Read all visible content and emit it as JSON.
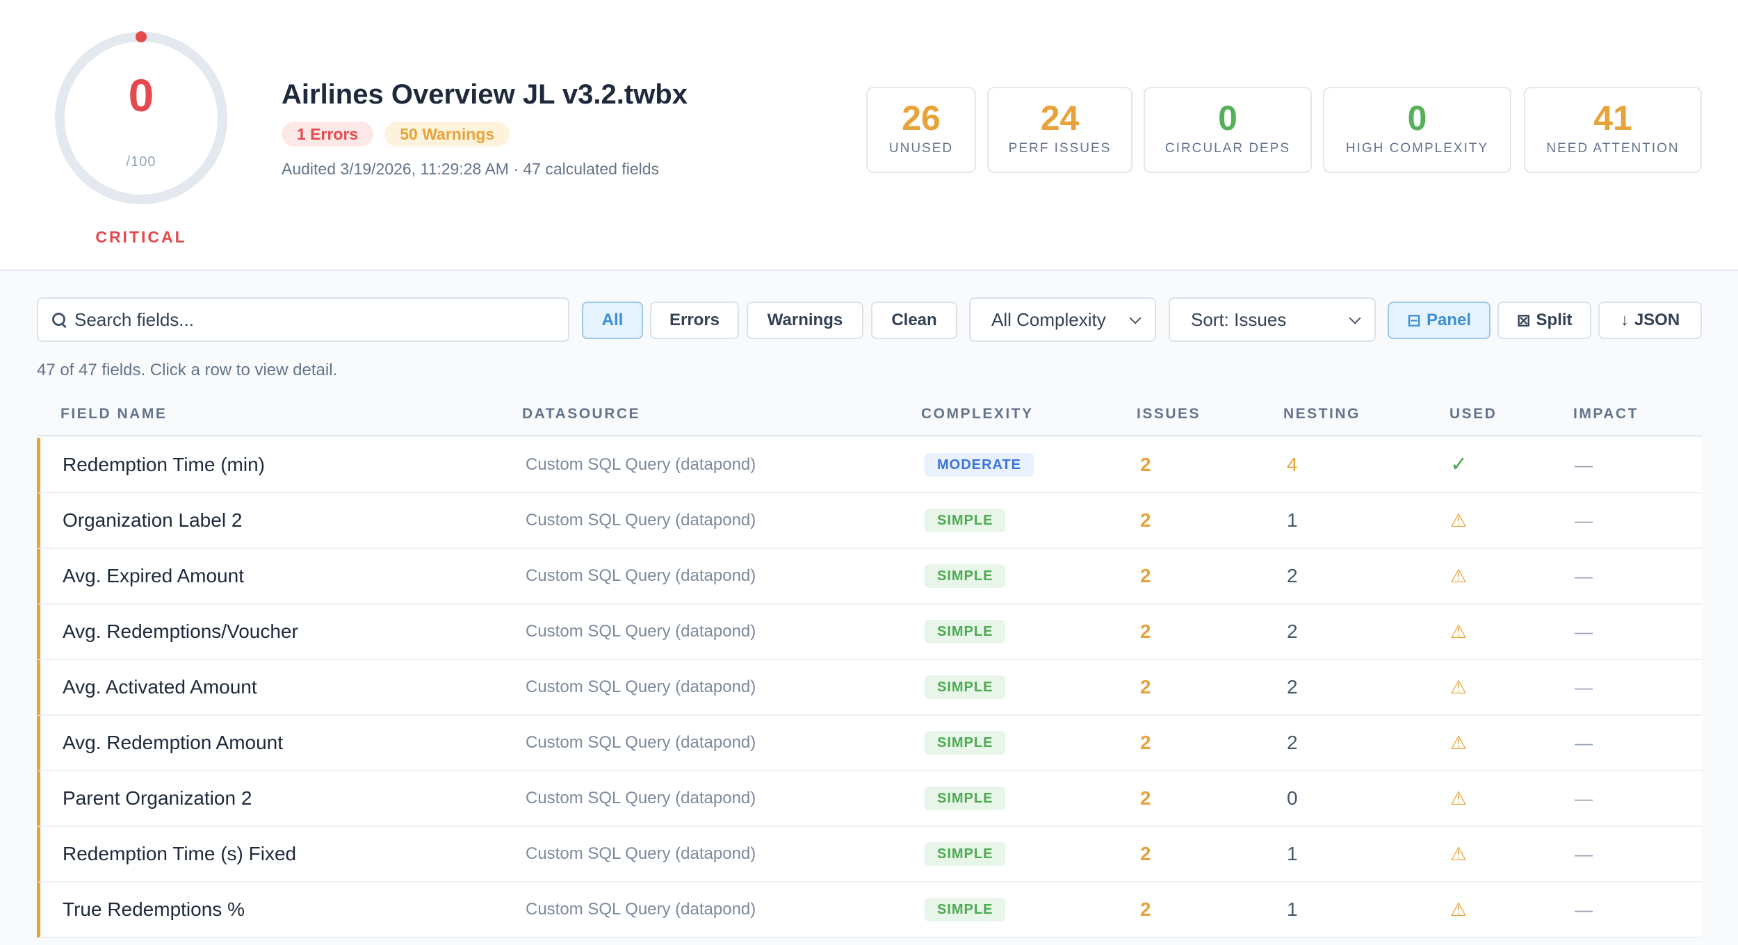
{
  "audit": {
    "score": "0",
    "score_max": "/100",
    "score_fraction": 0,
    "status": "CRITICAL",
    "title": "Airlines Overview JL v3.2.twbx",
    "errors_badge": "1 Errors",
    "warnings_badge": "50 Warnings",
    "meta": "Audited 3/19/2026, 11:29:28 AM · 47 calculated fields"
  },
  "stats": [
    {
      "value": "26",
      "label": "UNUSED",
      "color": "#e8a23a"
    },
    {
      "value": "24",
      "label": "PERF ISSUES",
      "color": "#e8a23a"
    },
    {
      "value": "0",
      "label": "CIRCULAR DEPS",
      "color": "#56b05a"
    },
    {
      "value": "0",
      "label": "HIGH COMPLEXITY",
      "color": "#56b05a"
    },
    {
      "value": "41",
      "label": "NEED ATTENTION",
      "color": "#e8a23a"
    }
  ],
  "toolbar": {
    "search_placeholder": "Search fields...",
    "filter_all": "All",
    "filter_errors": "Errors",
    "filter_warnings": "Warnings",
    "filter_clean": "Clean",
    "complexity_select": "All Complexity",
    "sort_select": "Sort: Issues",
    "panel_label": "Panel",
    "split_label": "Split",
    "json_label": "JSON",
    "panel_icon": "⊟",
    "split_icon": "⊠",
    "json_icon": "↓"
  },
  "summary": "47 of 47 fields. Click a row to view detail.",
  "table": {
    "headers": [
      "FIELD NAME",
      "DATASOURCE",
      "COMPLEXITY",
      "ISSUES",
      "NESTING",
      "USED",
      "IMPACT"
    ],
    "rows": [
      {
        "name": "Redemption Time (min)",
        "datasource": "Custom SQL Query (datapond)",
        "complexity": "MODERATE",
        "issues": "2",
        "nesting": "4",
        "used": "✓",
        "impact": "—"
      },
      {
        "name": "Organization Label 2",
        "datasource": "Custom SQL Query (datapond)",
        "complexity": "SIMPLE",
        "issues": "2",
        "nesting": "1",
        "used": "⚠",
        "impact": "—"
      },
      {
        "name": "Avg. Expired Amount",
        "datasource": "Custom SQL Query (datapond)",
        "complexity": "SIMPLE",
        "issues": "2",
        "nesting": "2",
        "used": "⚠",
        "impact": "—"
      },
      {
        "name": "Avg. Redemptions/Voucher",
        "datasource": "Custom SQL Query (datapond)",
        "complexity": "SIMPLE",
        "issues": "2",
        "nesting": "2",
        "used": "⚠",
        "impact": "—"
      },
      {
        "name": "Avg. Activated Amount",
        "datasource": "Custom SQL Query (datapond)",
        "complexity": "SIMPLE",
        "issues": "2",
        "nesting": "2",
        "used": "⚠",
        "impact": "—"
      },
      {
        "name": "Avg. Redemption Amount",
        "datasource": "Custom SQL Query (datapond)",
        "complexity": "SIMPLE",
        "issues": "2",
        "nesting": "2",
        "used": "⚠",
        "impact": "—"
      },
      {
        "name": "Parent Organization 2",
        "datasource": "Custom SQL Query (datapond)",
        "complexity": "SIMPLE",
        "issues": "2",
        "nesting": "0",
        "used": "⚠",
        "impact": "—"
      },
      {
        "name": "Redemption Time (s) Fixed",
        "datasource": "Custom SQL Query (datapond)",
        "complexity": "SIMPLE",
        "issues": "2",
        "nesting": "1",
        "used": "⚠",
        "impact": "—"
      },
      {
        "name": "True Redemptions %",
        "datasource": "Custom SQL Query (datapond)",
        "complexity": "SIMPLE",
        "issues": "2",
        "nesting": "1",
        "used": "⚠",
        "impact": "—"
      }
    ]
  }
}
